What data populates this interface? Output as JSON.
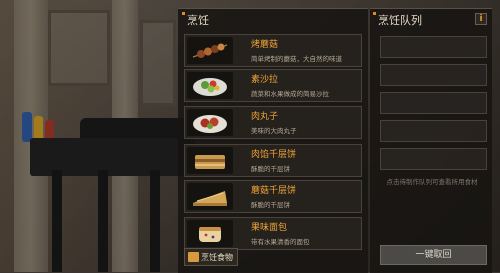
{
  "cooking_panel": {
    "title": "烹饪",
    "recipes": [
      {
        "name": "烤蘑菇",
        "desc": "简单烤制的蘑菇，大自然的味道",
        "icon": "grilled-mushroom-skewer"
      },
      {
        "name": "素沙拉",
        "desc": "蔬菜和水果做成的简易沙拉",
        "icon": "salad-plate"
      },
      {
        "name": "肉丸子",
        "desc": "美味的大肉丸子",
        "icon": "meatball-plate"
      },
      {
        "name": "肉馅千层饼",
        "desc": "酥脆的千层饼",
        "icon": "meat-layer-pie"
      },
      {
        "name": "蘑菇千层饼",
        "desc": "酥脆的千层饼",
        "icon": "mushroom-layer-pie"
      },
      {
        "name": "果味面包",
        "desc": "带有水果清香的面包",
        "icon": "fruit-bread"
      }
    ],
    "cook_food_button": "烹饪食物"
  },
  "queue_panel": {
    "title": "烹饪队列",
    "info_button": "i",
    "slot_count": 5,
    "hint": "点击待制作队列可查看所用食材",
    "quick_collect_button": "一键取回"
  },
  "colors": {
    "accent_orange": "#f1a437",
    "panel_bg": "#161412",
    "text_light": "#e8dcc6"
  }
}
